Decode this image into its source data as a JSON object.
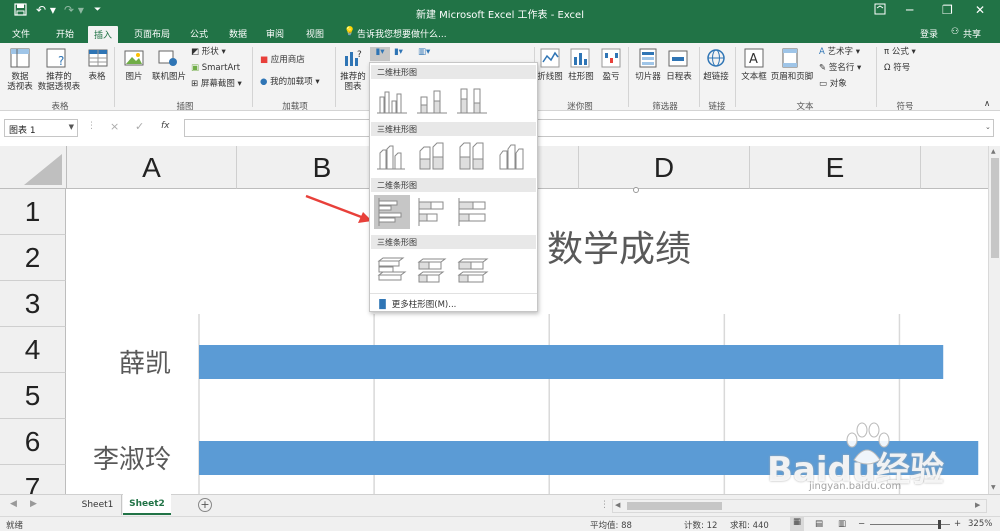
{
  "titlebar": {
    "title": "新建 Microsoft Excel 工作表 - Excel",
    "login": "登录"
  },
  "tabs": [
    "文件",
    "开始",
    "插入",
    "页面布局",
    "公式",
    "数据",
    "审阅",
    "视图"
  ],
  "active_tab": "插入",
  "tellme": "告诉我您想要做什么...",
  "share": "共享",
  "ribbon": {
    "pivot_table": "数据\n透视表",
    "recommended_pivot": "推荐的\n数据透视表",
    "table": "表格",
    "group_tables": "表格",
    "pictures": "图片",
    "online_pictures": "联机图片",
    "shapes": "形状",
    "smartart": "SmartArt",
    "screenshot": "屏幕截图",
    "group_illustrations": "插图",
    "store": "应用商店",
    "my_addins": "我的加载项",
    "group_addins": "加载项",
    "recommended_charts": "推荐的\n图表",
    "sparkline_line": "折线图",
    "sparkline_column": "柱形图",
    "sparkline_winloss": "盈亏",
    "group_sparklines": "迷你图",
    "slicer": "切片器",
    "timeline": "日程表",
    "group_filters": "筛选器",
    "hyperlink": "超链接",
    "group_links": "链接",
    "textbox": "文本框",
    "header_footer": "页眉和页脚",
    "wordart": "艺术字",
    "signature": "签名行",
    "object": "对象",
    "group_text": "文本",
    "equation": "公式",
    "symbol": "符号",
    "group_symbols": "符号"
  },
  "formula_bar": {
    "name_box": "图表 1",
    "cancel": "×",
    "enter": "✓",
    "fx": "fx",
    "formula": ""
  },
  "columns": [
    "A",
    "B",
    "C",
    "D",
    "E"
  ],
  "rows": [
    "1",
    "2",
    "3",
    "4",
    "5",
    "6",
    "7"
  ],
  "dropdown": {
    "section1": "二维柱形图",
    "section2": "三维柱形图",
    "section3": "二维条形图",
    "section4": "三维条形图",
    "more": "更多柱形图(M)..."
  },
  "chart_data": {
    "type": "bar",
    "title": "数学成绩",
    "categories": [
      "薛凯",
      "李淑玲"
    ],
    "values": [
      85,
      89
    ],
    "xlim": [
      0,
      90
    ],
    "bar_color": "#5b9bd5",
    "grid": true
  },
  "sheet_tabs": [
    "Sheet1",
    "Sheet2"
  ],
  "active_sheet": "Sheet2",
  "status": {
    "ready": "就绪",
    "average": "平均值: 88",
    "count": "计数: 12",
    "sum": "求和: 440",
    "zoom": "325%"
  },
  "watermark": {
    "brand": "Baidu经验",
    "url": "jingyan.baidu.com"
  },
  "colors": {
    "excel_green": "#217346",
    "accent_red": "#e8403a"
  }
}
